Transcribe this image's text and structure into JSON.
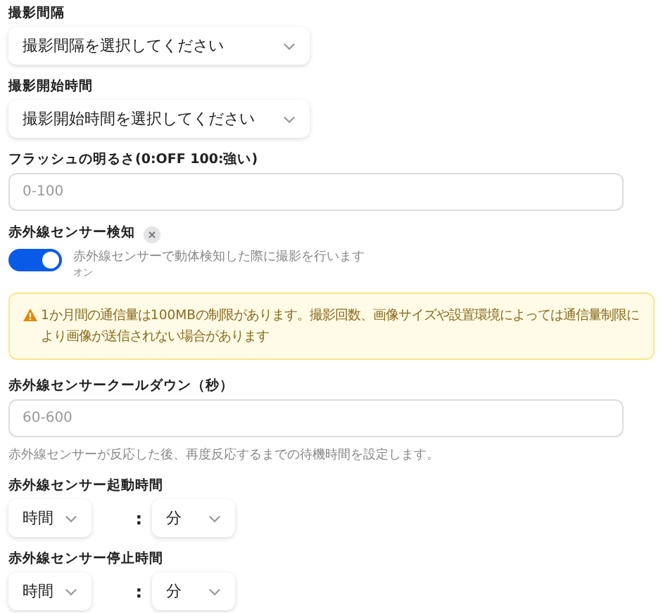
{
  "fields": [
    {
      "kind": "select",
      "label": "撮影間隔",
      "placeholder": "撮影間隔を選択してください"
    },
    {
      "kind": "select",
      "label": "撮影開始時間",
      "placeholder": "撮影開始時間を選択してください"
    },
    {
      "kind": "input",
      "label": "フラッシュの明るさ(0:OFF 100:強い)",
      "placeholder": "0-100"
    },
    {
      "kind": "toggle",
      "label": "赤外線センサー検知",
      "on": true,
      "description": "赤外線センサーで動体検知した際に撮影を行います",
      "state_text": "オン"
    },
    {
      "kind": "notice",
      "text": "1か月間の通信量は100MBの制限があります。撮影回数、画像サイズや設置環境によっては通信量制限により画像が送信されない場合があります"
    },
    {
      "kind": "input",
      "label": "赤外線センサークールダウン（秒）",
      "placeholder": "60-600",
      "help": "赤外線センサーが反応した後、再度反応するまでの待機時間を設定します。"
    },
    {
      "kind": "time",
      "label": "赤外線センサー起動時間",
      "hour_placeholder": "時間",
      "separator": ":",
      "minute_placeholder": "分"
    },
    {
      "kind": "time",
      "label": "赤外線センサー停止時間",
      "hour_placeholder": "時間",
      "separator": ":",
      "minute_placeholder": "分"
    }
  ]
}
